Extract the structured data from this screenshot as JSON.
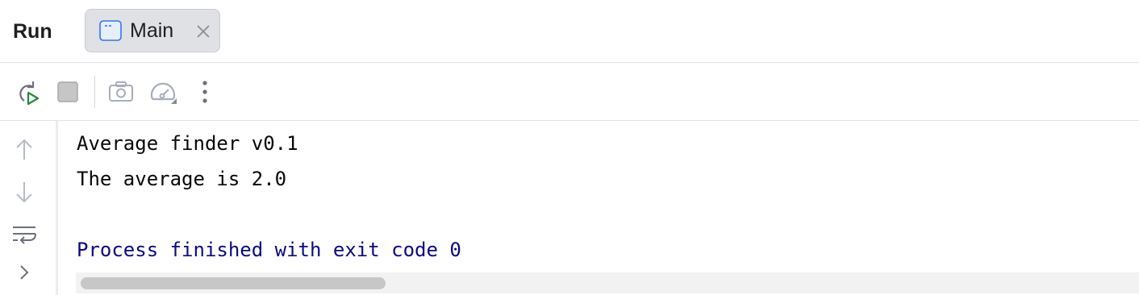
{
  "panel": {
    "title": "Run"
  },
  "tabs": [
    {
      "label": "Main",
      "icon": "application-icon",
      "active": true,
      "closable": true
    }
  ],
  "toolbar": {
    "buttons": [
      {
        "name": "rerun-button",
        "icon": "rerun-icon"
      },
      {
        "name": "stop-button",
        "icon": "stop-icon",
        "enabled": false
      },
      {
        "name": "dump-threads-button",
        "icon": "camera-icon",
        "enabled": false
      },
      {
        "name": "profiler-button",
        "icon": "speedometer-icon",
        "enabled": false
      },
      {
        "name": "more-button",
        "icon": "vertical-ellipsis-icon"
      }
    ]
  },
  "gutter": {
    "buttons": [
      {
        "name": "scroll-up-button",
        "icon": "arrow-up-icon"
      },
      {
        "name": "scroll-down-button",
        "icon": "arrow-down-icon"
      },
      {
        "name": "soft-wrap-button",
        "icon": "soft-wrap-icon"
      },
      {
        "name": "expand-button",
        "icon": "chevron-right-icon"
      }
    ]
  },
  "console": {
    "lines": [
      {
        "text": "Average finder v0.1",
        "type": "output"
      },
      {
        "text": "The average is 2.0",
        "type": "output"
      },
      {
        "text": "",
        "type": "output"
      },
      {
        "text": "Process finished with exit code 0",
        "type": "system"
      }
    ]
  },
  "colors": {
    "accent": "#3574f0",
    "run_green": "#208a3c",
    "system_text": "#0a0a80",
    "tab_background": "#dfe1e5"
  }
}
